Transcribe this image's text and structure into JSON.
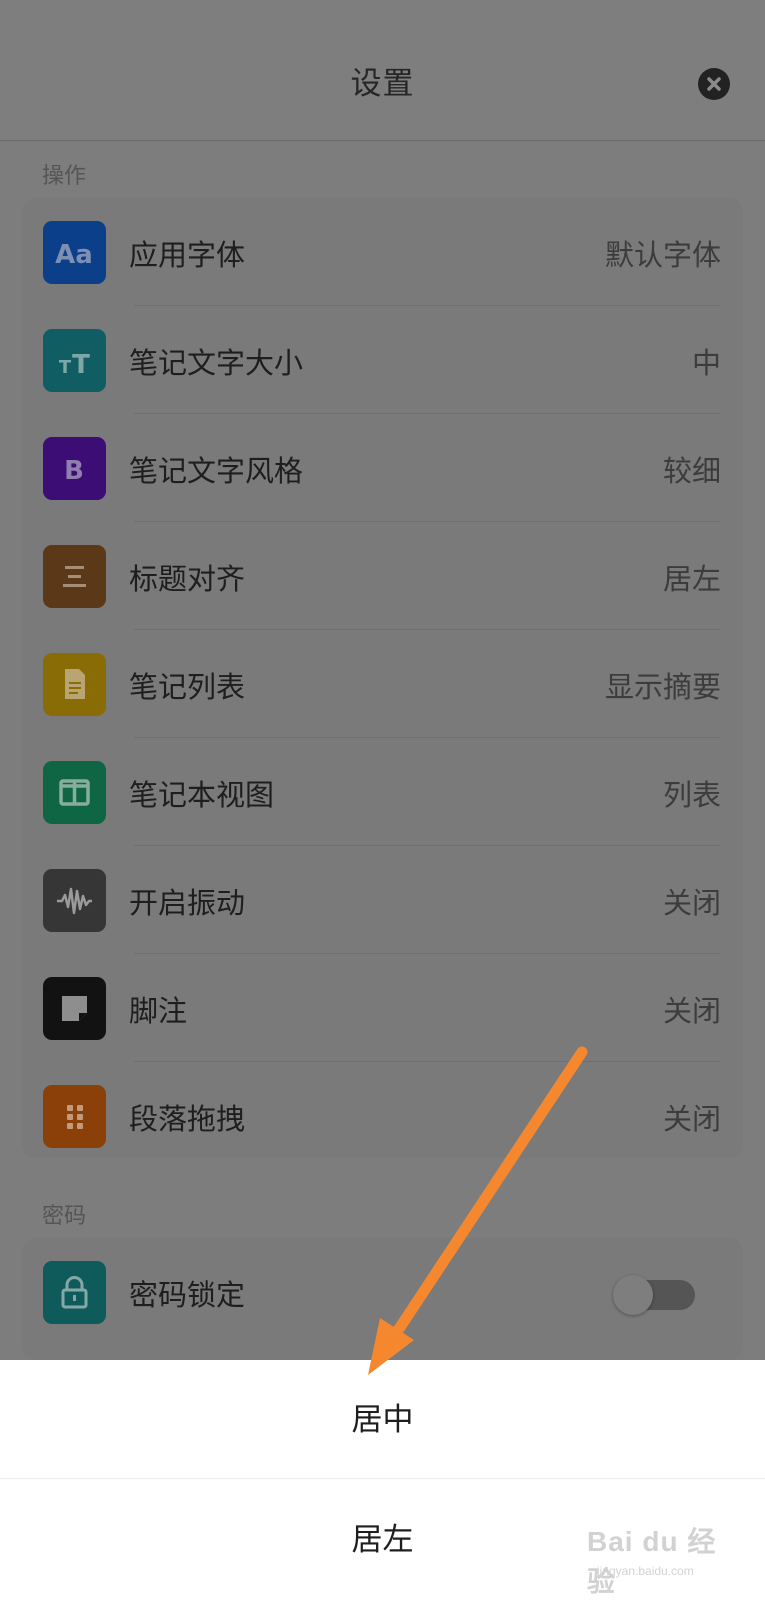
{
  "header": {
    "title": "设置"
  },
  "sections": {
    "operations": {
      "title": "操作",
      "items": [
        {
          "label": "应用字体",
          "value": "默认字体",
          "icon": "font-aa-icon",
          "color": "#0c3f8a"
        },
        {
          "label": "笔记文字大小",
          "value": "中",
          "icon": "text-size-icon",
          "color": "#105e63"
        },
        {
          "label": "笔记文字风格",
          "value": "较细",
          "icon": "bold-b-icon",
          "color": "#3c0d74"
        },
        {
          "label": "标题对齐",
          "value": "居左",
          "icon": "align-center-icon",
          "color": "#5a3818"
        },
        {
          "label": "笔记列表",
          "value": "显示摘要",
          "icon": "document-icon",
          "color": "#8a6c07"
        },
        {
          "label": "笔记本视图",
          "value": "列表",
          "icon": "columns-icon",
          "color": "#0f6645"
        },
        {
          "label": "开启振动",
          "value": "关闭",
          "icon": "waveform-icon",
          "color": "#363636"
        },
        {
          "label": "脚注",
          "value": "关闭",
          "icon": "note-icon",
          "color": "#121212"
        },
        {
          "label": "段落拖拽",
          "value": "关闭",
          "icon": "drag-grid-icon",
          "color": "#8a4008"
        }
      ]
    },
    "password": {
      "title": "密码",
      "items": [
        {
          "label": "密码锁定",
          "icon": "lock-icon",
          "color": "#0f5a5a",
          "toggle_on": false
        }
      ]
    }
  },
  "action_sheet": {
    "options": [
      "居中",
      "居左"
    ]
  },
  "annotation": {
    "arrow_color": "#f5882e"
  },
  "watermark": {
    "text": "Bai du 经验",
    "sub": "jingyan.baidu.com"
  }
}
